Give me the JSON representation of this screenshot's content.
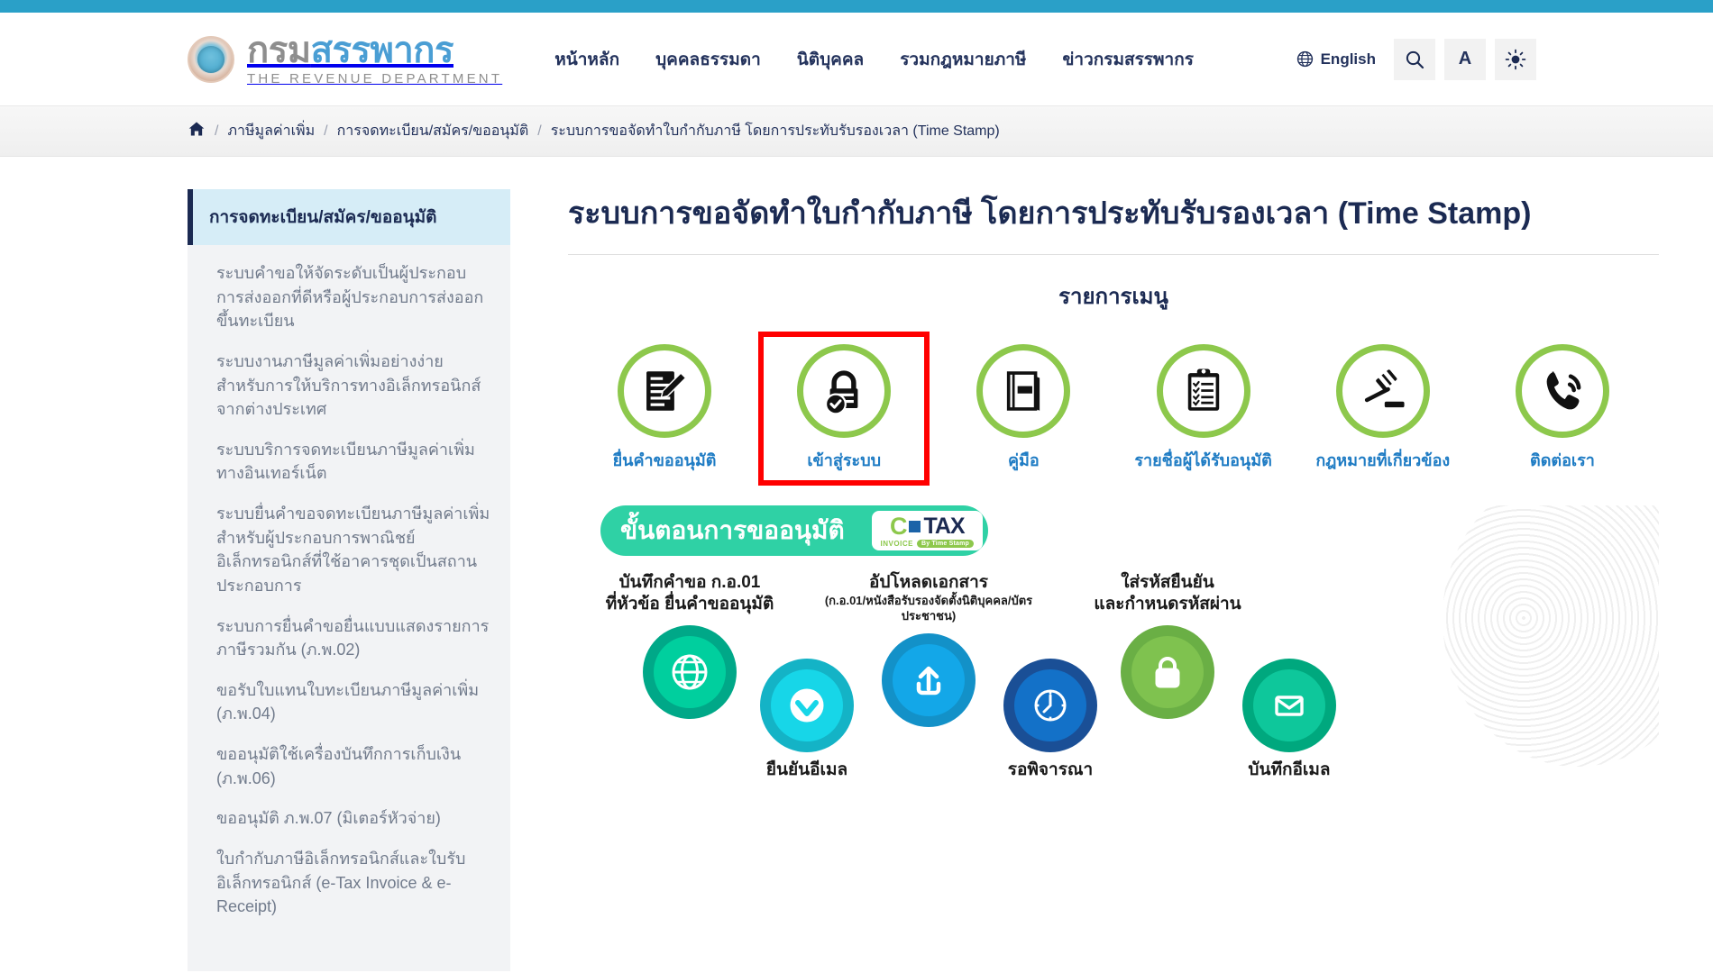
{
  "header": {
    "brand_th_part1": "กรม",
    "brand_th_part2": "สรรพากร",
    "brand_en": "THE REVENUE DEPARTMENT",
    "nav": [
      {
        "label": "หน้าหลัก"
      },
      {
        "label": "บุคคลธรรมดา"
      },
      {
        "label": "นิติบุคคล"
      },
      {
        "label": "รวมกฎหมายภาษี"
      },
      {
        "label": "ข่าวกรมสรรพากร"
      }
    ],
    "language_label": "English",
    "search_label": "Q",
    "fontsize_label": "A",
    "theme_label": "☀"
  },
  "breadcrumb": {
    "home_label": "หน้าแรก",
    "items": [
      {
        "label": "ภาษีมูลค่าเพิ่ม"
      },
      {
        "label": "การจดทะเบียน/สมัคร/ขออนุมัติ"
      },
      {
        "label": "ระบบการขอจัดทำใบกำกับภาษี โดยการประทับรับรองเวลา (Time Stamp)"
      }
    ],
    "separator": "/"
  },
  "sidebar": {
    "heading": "การจดทะเบียน/สมัคร/ขออนุมัติ",
    "items": [
      {
        "label": "ระบบคำขอให้จัดระดับเป็นผู้ประกอบการส่งออกที่ดีหรือผู้ประกอบการส่งออกขึ้นทะเบียน"
      },
      {
        "label": "ระบบงานภาษีมูลค่าเพิ่มอย่างง่ายสำหรับการให้บริการทางอิเล็กทรอนิกส์จากต่างประเทศ"
      },
      {
        "label": "ระบบบริการจดทะเบียนภาษีมูลค่าเพิ่มทางอินเทอร์เน็ต"
      },
      {
        "label": "ระบบยื่นคำขอจดทะเบียนภาษีมูลค่าเพิ่มสำหรับผู้ประกอบการพาณิชย์อิเล็กทรอนิกส์ที่ใช้อาคารชุดเป็นสถานประกอบการ"
      },
      {
        "label": "ระบบการยื่นคำขอยื่นแบบแสดงรายการภาษีรวมกัน (ภ.พ.02)"
      },
      {
        "label": "ขอรับใบแทนใบทะเบียนภาษีมูลค่าเพิ่ม (ภ.พ.04)"
      },
      {
        "label": "ขออนุมัติใช้เครื่องบันทึกการเก็บเงิน (ภ.พ.06)"
      },
      {
        "label": "ขออนุมัติ ภ.พ.07 (มิเตอร์หัวจ่าย)"
      },
      {
        "label": "ใบกำกับภาษีอิเล็กทรอนิกส์และใบรับอิเล็กทรอนิกส์ (e-Tax Invoice & e-Receipt)"
      }
    ]
  },
  "main": {
    "title": "ระบบการขอจัดทำใบกำกับภาษี โดยการประทับรับรองเวลา (Time Stamp)",
    "menu_heading": "รายการเมนู",
    "tiles": [
      {
        "label": "ยื่นคำขออนุมัติ",
        "icon": "document-edit-icon",
        "highlighted": false
      },
      {
        "label": "เข้าสู่ระบบ",
        "icon": "lock-check-icon",
        "highlighted": true
      },
      {
        "label": "คู่มือ",
        "icon": "book-icon",
        "highlighted": false
      },
      {
        "label": "รายชื่อผู้ได้รับอนุมัติ",
        "icon": "clipboard-checklist-icon",
        "highlighted": false
      },
      {
        "label": "กฎหมายที่เกี่ยวข้อง",
        "icon": "gavel-icon",
        "highlighted": false
      },
      {
        "label": "ติดต่อเรา",
        "icon": "phone-icon",
        "highlighted": false
      }
    ]
  },
  "infographic": {
    "banner_text": "ขั้นตอนการขออนุมัติ",
    "logo": {
      "e": "C",
      "tax": "TAX",
      "invoice": "INVOICE",
      "by": "By Time Stamp"
    },
    "steps": [
      {
        "title": "บันทึกคำขอ ก.อ.01",
        "subtitle": "ที่หัวข้อ ยื่นคำขออนุมัติ",
        "icon": "globe-icon",
        "color": "#00a888",
        "inner": "#00cf9e",
        "position": "above"
      },
      {
        "title": "ยืนยันอีเมล",
        "subtitle": "",
        "icon": "check-circle-icon",
        "color": "#14b3c6",
        "inner": "#17d6e8",
        "position": "below"
      },
      {
        "title": "อัปโหลดเอกสาร",
        "subtitle": "(ก.อ.01/หนังสือรับรองจัดตั้งนิติบุคคล/บัตรประชาชน)",
        "icon": "upload-icon",
        "color": "#1391c8",
        "inner": "#13a7e8",
        "position": "above"
      },
      {
        "title": "รอพิจารณา",
        "subtitle": "",
        "icon": "clock-icon",
        "color": "#1a4f96",
        "inner": "#1371c8",
        "position": "below"
      },
      {
        "title": "ใส่รหัสยืนยัน",
        "subtitle": "และกำหนดรหัสผ่าน",
        "icon": "padlock-icon",
        "color": "#6aaf45",
        "inner": "#7fc24f",
        "position": "above"
      },
      {
        "title": "บันทึกอีเมล",
        "subtitle": "",
        "icon": "envelope-icon",
        "color": "#00a87e",
        "inner": "#0ec79b",
        "position": "below"
      }
    ]
  },
  "colors": {
    "accent_bar": "#2aa0c8",
    "navy": "#23325c",
    "tile_ring": "#8dc84c",
    "tile_label": "#1f7cc4",
    "highlight_box": "#ff0000",
    "sidebar_head_bg": "#d6edf7"
  }
}
